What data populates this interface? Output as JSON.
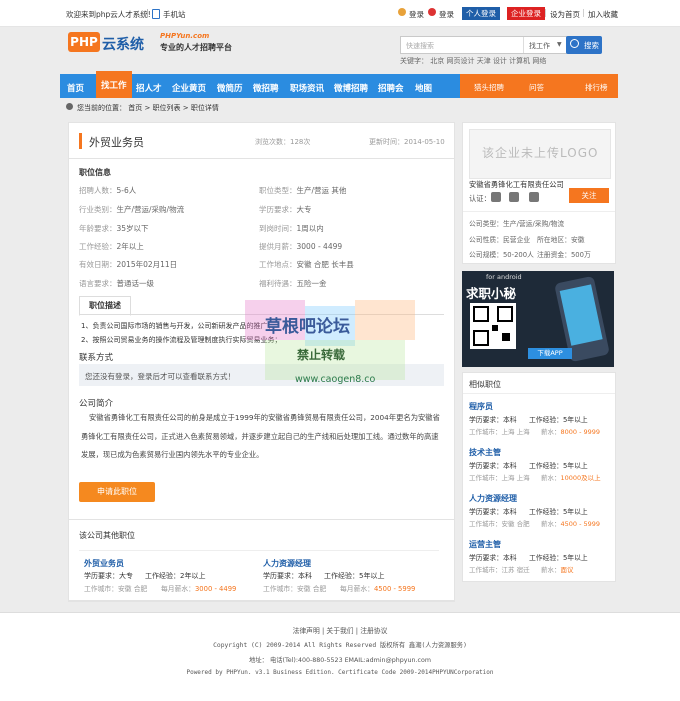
{
  "topbar": {
    "welcome": "欢迎来到php云人才系统!",
    "mobile": "手机站",
    "login1": "登录",
    "login2": "登录",
    "personal_login": "个人登录",
    "company_login": "企业登录",
    "set_home": "设为首页",
    "add_fav": "加入收藏"
  },
  "header": {
    "logo_main": "PHP云系统",
    "logo_url": "PHPYun.com",
    "logo_slogan": "专业的人才招聘平台",
    "search_placeholder": "快速搜索",
    "search_type": "找工作",
    "search_button": "搜索",
    "hot_label": "关键字：",
    "hot_words": [
      "北京",
      "网页设计",
      "天津",
      "设计",
      "计算机",
      "网络"
    ]
  },
  "nav": {
    "items": [
      "首页",
      "找工作",
      "招人才",
      "企业黄页",
      "微简历",
      "微招聘",
      "职场资讯",
      "微博招聘",
      "招聘会",
      "地图"
    ],
    "right": [
      "猎头招聘",
      "问答",
      "排行榜"
    ]
  },
  "breadcrumb": {
    "prefix": "您当前的位置：",
    "items": [
      "首页",
      "职位列表",
      "职位详情"
    ]
  },
  "job": {
    "title": "外贸业务员",
    "views_label": "浏览次数：",
    "views": "128次",
    "update_label": "更新时间：",
    "update": "2014-05-10",
    "info_title": "职位信息",
    "fields_left": [
      {
        "label": "招聘人数：",
        "value": "5-6人"
      },
      {
        "label": "行业类别：",
        "value": "生产/营运/采购/物流"
      },
      {
        "label": "年龄要求：",
        "value": "35岁以下"
      },
      {
        "label": "工作经验：",
        "value": "2年以上"
      },
      {
        "label": "有效日期：",
        "value": "2015年02月11日"
      },
      {
        "label": "语言要求：",
        "value": "普通话一级"
      }
    ],
    "fields_right": [
      {
        "label": "职位类型：",
        "value": "生产/营运 其他"
      },
      {
        "label": "学历要求：",
        "value": "大专"
      },
      {
        "label": "到岗时间：",
        "value": "1周以内"
      },
      {
        "label": "提供月薪：",
        "value": "3000 - 4499"
      },
      {
        "label": "工作地点：",
        "value": "安徽 合肥 长丰县"
      },
      {
        "label": "福利待遇：",
        "value": "五险一金"
      }
    ],
    "desc_tab": "职位描述",
    "desc_lines": [
      "1、负责公司国际市场的销售与开发，公司新研发产品的推广；",
      "2、按照公司贸易业务的操作流程及管理制度执行实际贸易业务；"
    ],
    "contact_title": "联系方式",
    "contact_text": "您还没有登录，登录后才可以查看联系方式！",
    "company_title": "公司简介",
    "company_text": "安徽省勇锋化工有限责任公司的前身是成立于1999年的安徽省勇锋贸易有限责任公司，2004年更名为安徽省勇锋化工有限责任公司，正式进入色素贸易领域，并逐步建立起自己的生产线和后处理加工线。通过数年的高速发展，现已成为色素贸易行业国内领先水平的专业企业。",
    "apply_button": "申请此职位"
  },
  "other_jobs": {
    "title": "该公司其他职位",
    "items": [
      {
        "name": "外贸业务员",
        "edu": "学历要求：大专",
        "exp": "工作经验：2年以上",
        "city": "工作城市：安徽 合肥",
        "salary_label": "每月薪水：",
        "salary": "3000 - 4499"
      },
      {
        "name": "人力资源经理",
        "edu": "学历要求：本科",
        "exp": "工作经验：5年以上",
        "city": "工作城市：安徽 合肥",
        "salary_label": "每月薪水：",
        "salary": "4500 - 5999"
      }
    ]
  },
  "company_card": {
    "logo_placeholder": "该企业未上传LOGO",
    "name": "安徽省勇锋化工有限责任公司",
    "verify_label": "认证：",
    "follow": "关注",
    "type": "公司类型：生产/营运/采购/物流",
    "nature": "公司性质：民营企业",
    "city": "所在地区：安徽",
    "scale": "公司规模：50-200人",
    "capital": "注册资金：500万"
  },
  "app_banner": {
    "small": "for android",
    "title": "求职小秘",
    "download": "下载APP"
  },
  "similar": {
    "title": "相似职位",
    "items": [
      {
        "name": "程序员",
        "edu": "学历要求：本科",
        "exp": "工作经验：5年以上",
        "city": "工作城市：上海 上海",
        "salary_label": "薪水：",
        "salary": "8000 - 9999"
      },
      {
        "name": "技术主管",
        "edu": "学历要求：本科",
        "exp": "工作经验：5年以上",
        "city": "工作城市：上海 上海",
        "salary_label": "薪水：",
        "salary": "10000及以上"
      },
      {
        "name": "人力资源经理",
        "edu": "学历要求：本科",
        "exp": "工作经验：5年以上",
        "city": "工作城市：安徽 合肥",
        "salary_label": "薪水：",
        "salary": "4500 - 5999"
      },
      {
        "name": "运营主管",
        "edu": "学历要求：本科",
        "exp": "工作经验：5年以上",
        "city": "工作城市：江苏 宿迁",
        "salary_label": "薪水：",
        "salary": "面议"
      }
    ]
  },
  "footer": {
    "links": [
      "法律声明",
      "关于我们",
      "注册协议"
    ],
    "copyright": "Copyright (C) 2009-2014 All Rights Reserved 版权所有 鑫潮(人力资源服务)",
    "address": "地址： 电话(Tel):400-880-5523 EMAIL:admin@phpyun.com",
    "powered": "Powered by PHPYun. v3.1 Business Edition. Certificate Code 2009-2014PHPYUNCorporation"
  },
  "watermark": {
    "line1": "草根吧论坛",
    "line2": "禁止转载",
    "line3": "www.caogen8.co"
  }
}
